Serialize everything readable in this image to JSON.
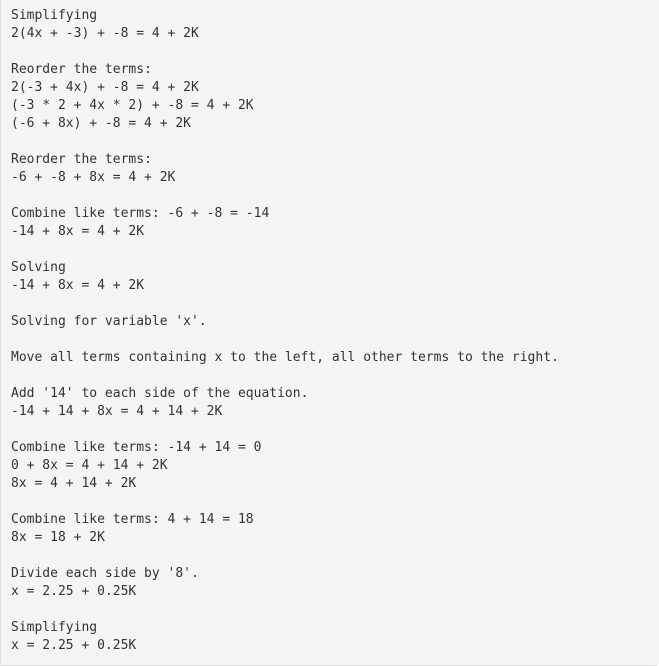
{
  "document": {
    "kind": "algebra-solution-log",
    "background_color": "#f5f5f5",
    "page_background_color": "#ffffff",
    "text_color": "#333333",
    "border_color": "#e0e0e0",
    "blocks": [
      {
        "heading": "Simplifying",
        "lines": [
          "2(4x + -3) + -8 = 4 + 2K"
        ]
      },
      {
        "heading": "Reorder the terms:",
        "lines": [
          "2(-3 + 4x) + -8 = 4 + 2K",
          "(-3 * 2 + 4x * 2) + -8 = 4 + 2K",
          "(-6 + 8x) + -8 = 4 + 2K"
        ]
      },
      {
        "heading": "Reorder the terms:",
        "lines": [
          "-6 + -8 + 8x = 4 + 2K"
        ]
      },
      {
        "heading": "Combine like terms: -6 + -8 = -14",
        "lines": [
          "-14 + 8x = 4 + 2K"
        ]
      },
      {
        "heading": "Solving",
        "lines": [
          "-14 + 8x = 4 + 2K"
        ]
      },
      {
        "heading": "Solving for variable 'x'.",
        "lines": []
      },
      {
        "heading": "Move all terms containing x to the left, all other terms to the right.",
        "lines": []
      },
      {
        "heading": "Add '14' to each side of the equation.",
        "lines": [
          "-14 + 14 + 8x = 4 + 14 + 2K"
        ]
      },
      {
        "heading": "Combine like terms: -14 + 14 = 0",
        "lines": [
          "0 + 8x = 4 + 14 + 2K",
          "8x = 4 + 14 + 2K"
        ]
      },
      {
        "heading": "Combine like terms: 4 + 14 = 18",
        "lines": [
          "8x = 18 + 2K"
        ]
      },
      {
        "heading": "Divide each side by '8'.",
        "lines": [
          "x = 2.25 + 0.25K"
        ]
      },
      {
        "heading": "Simplifying",
        "lines": [
          "x = 2.25 + 0.25K"
        ]
      }
    ]
  }
}
